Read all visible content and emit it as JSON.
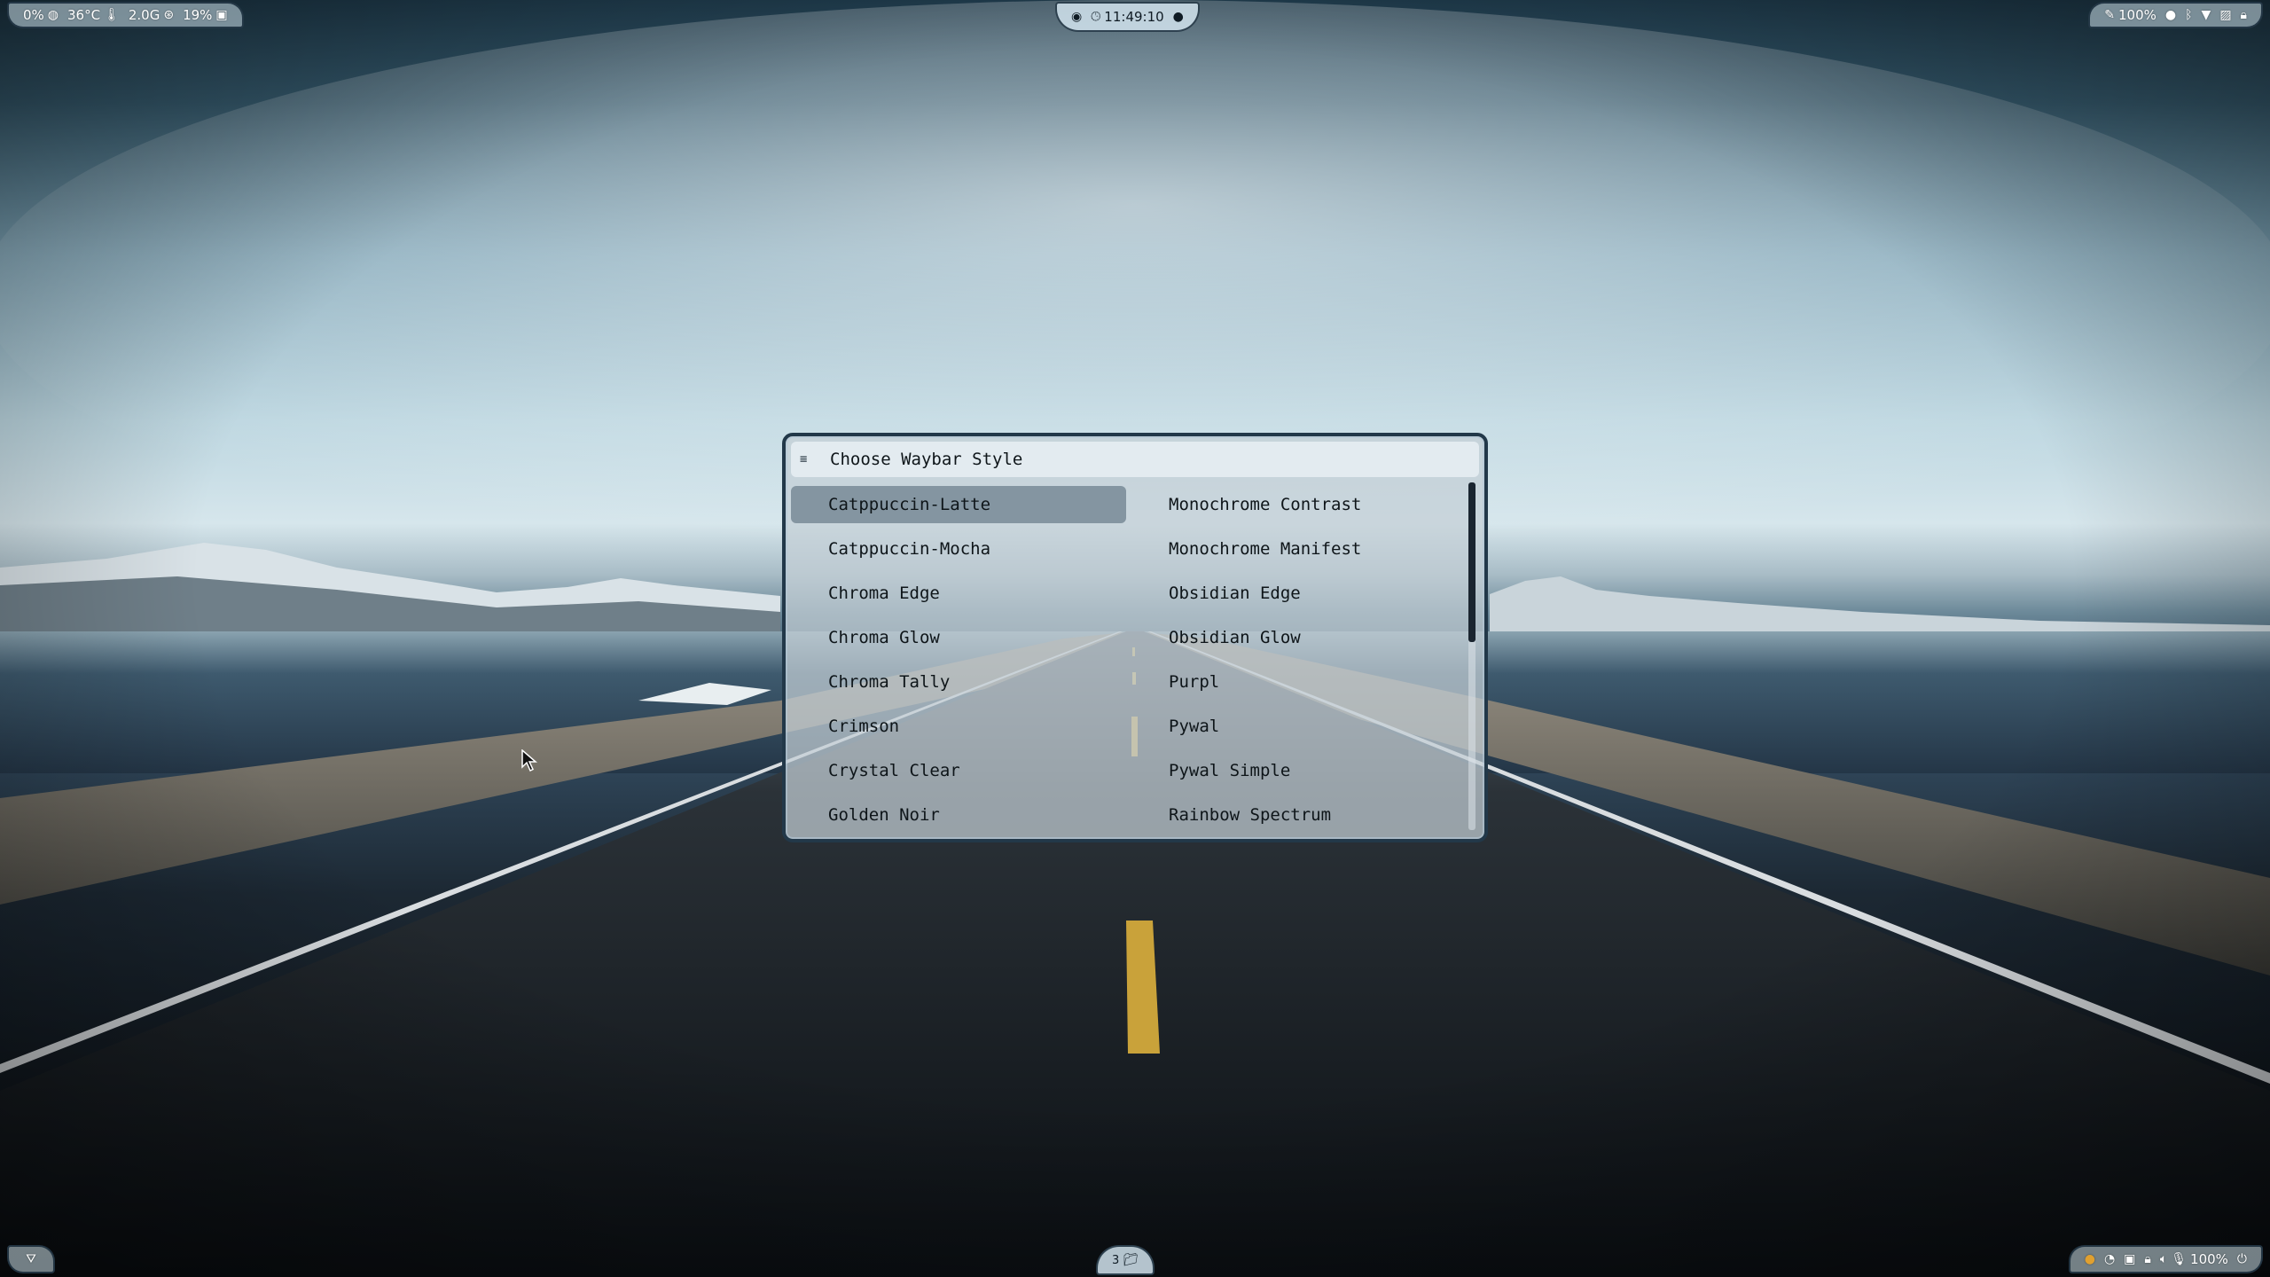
{
  "top_left": {
    "cpu": "0%",
    "temperature": "36°C",
    "memory": "2.0G",
    "disk": "19%"
  },
  "top_center": {
    "clock": "11:49:10"
  },
  "top_right": {
    "brightness": "100%"
  },
  "bottom_center": {
    "workspace": "3"
  },
  "bottom_right": {
    "volume": "100%"
  },
  "rofi": {
    "prompt": "Choose Waybar Style",
    "prompt_icon": "menu-lines-icon",
    "items": [
      "Catppuccin-Latte",
      "Monochrome Contrast",
      "Catppuccin-Mocha",
      "Monochrome Manifest",
      "Chroma Edge",
      "Obsidian Edge",
      "Chroma Glow",
      "Obsidian Glow",
      "Chroma Tally",
      "Purpl",
      "Crimson",
      "Pywal",
      "Crystal Clear",
      "Pywal Simple",
      "Golden Noir",
      "Rainbow Spectrum"
    ],
    "selected_index": 0
  },
  "colors": {
    "accent": "#223849",
    "selection": "#788a96",
    "bar_bg": "#cde1eb"
  }
}
